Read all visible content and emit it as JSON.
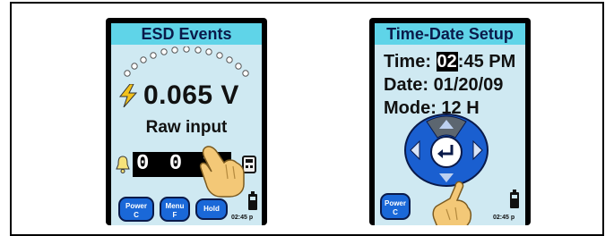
{
  "left_device": {
    "title": "ESD Events",
    "reading": "0.065 V",
    "caption": "Raw input",
    "counter": "0 0 3",
    "buttons": [
      {
        "label": "Power",
        "sub": "C"
      },
      {
        "label": "Menu",
        "sub": "F"
      },
      {
        "label": "Hold",
        "sub": ""
      }
    ],
    "clock": "02:45 p",
    "colors": {
      "title_bar": "#5fd4e8",
      "screen": "#cfe9f2",
      "button": "#1a68d8"
    }
  },
  "right_device": {
    "title": "Time-Date Setup",
    "time_label": "Time:",
    "time_hour": "02",
    "time_rest": ":45 PM",
    "date_line": "Date: 01/20/09",
    "mode_line": "Mode: 12 H",
    "buttons": [
      {
        "label": "Power",
        "sub": "C"
      }
    ],
    "clock": "02:45 p"
  },
  "icons": [
    "lightning-icon",
    "bell-icon",
    "calculator-icon",
    "battery-icon",
    "finger-pointer-icon",
    "enter-icon",
    "arrow-up-icon",
    "arrow-down-icon",
    "arrow-left-icon",
    "arrow-right-icon"
  ]
}
